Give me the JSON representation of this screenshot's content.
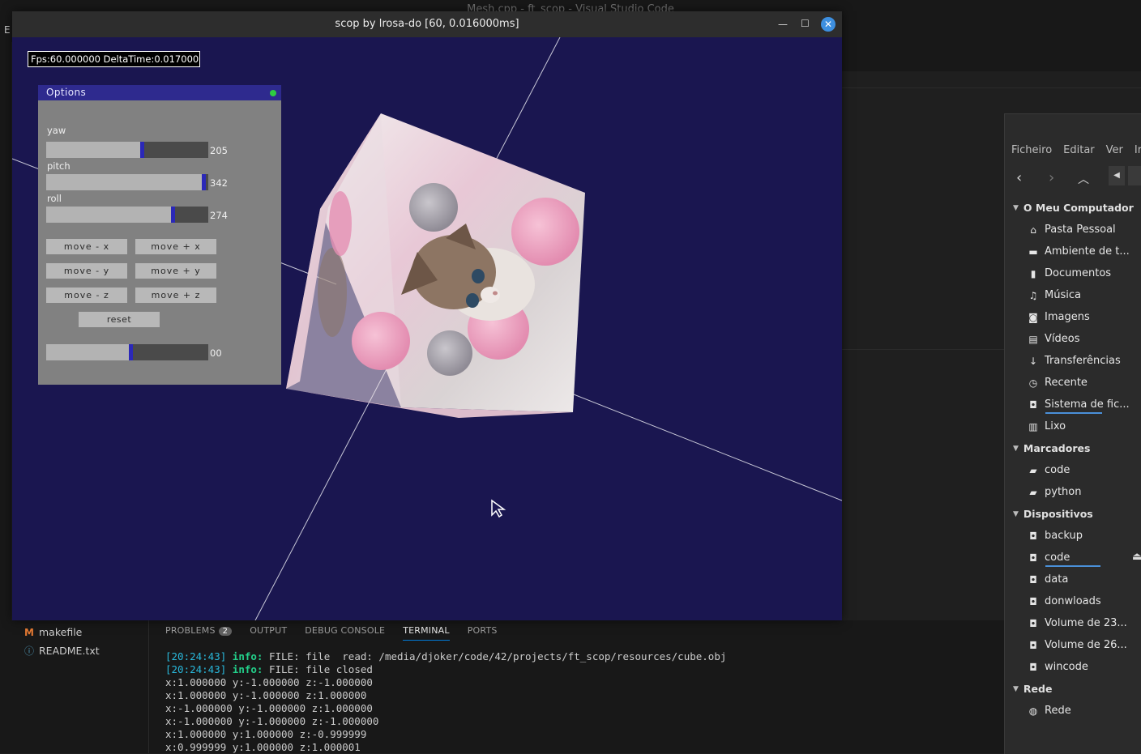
{
  "vscode": {
    "title": "Mesh.cpp - ft_scop - Visual Studio Code",
    "menu_first": "E",
    "files": [
      {
        "icon": "M",
        "name": "makefile"
      },
      {
        "icon": "ⓘ",
        "name": "README.txt"
      }
    ],
    "panel": {
      "tabs": [
        {
          "label": "PROBLEMS",
          "badge": "2"
        },
        {
          "label": "OUTPUT"
        },
        {
          "label": "DEBUG CONSOLE"
        },
        {
          "label": "TERMINAL",
          "active": true
        },
        {
          "label": "PORTS"
        }
      ],
      "terminal_lines": [
        {
          "stamp": "[20:24:43]",
          "level": "info:",
          "text": " FILE: file  read: /media/djoker/code/42/projects/ft_scop/resources/cube.obj"
        },
        {
          "stamp": "[20:24:43]",
          "level": "info:",
          "text": " FILE: file closed"
        },
        {
          "text": "x:1.000000 y:-1.000000 z:-1.000000"
        },
        {
          "text": "x:1.000000 y:-1.000000 z:1.000000"
        },
        {
          "text": "x:-1.000000 y:-1.000000 z:1.000000"
        },
        {
          "text": "x:-1.000000 y:-1.000000 z:-1.000000"
        },
        {
          "text": "x:1.000000 y:1.000000 z:-0.999999"
        },
        {
          "text": "x:0.999999 y:1.000000 z:1.000001"
        }
      ]
    }
  },
  "file_manager": {
    "menu": [
      "Ficheiro",
      "Editar",
      "Ver",
      "Ir"
    ],
    "sections": [
      {
        "title": "O Meu Computador",
        "items": [
          {
            "icon": "home-icon",
            "glyph": "⌂",
            "label": "Pasta Pessoal"
          },
          {
            "icon": "desktop-icon",
            "glyph": "▬",
            "label": "Ambiente de t..."
          },
          {
            "icon": "document-icon",
            "glyph": "▮",
            "label": "Documentos"
          },
          {
            "icon": "music-icon",
            "glyph": "♫",
            "label": "Música"
          },
          {
            "icon": "camera-icon",
            "glyph": "◙",
            "label": "Imagens"
          },
          {
            "icon": "film-icon",
            "glyph": "▤",
            "label": "Vídeos"
          },
          {
            "icon": "download-icon",
            "glyph": "↓",
            "label": "Transferências"
          },
          {
            "icon": "clock-icon",
            "glyph": "◷",
            "label": "Recente"
          },
          {
            "icon": "drive-icon",
            "glyph": "◘",
            "label": "Sistema de fic..."
          },
          {
            "icon": "trash-icon",
            "glyph": "▥",
            "label": "Lixo"
          }
        ]
      },
      {
        "title": "Marcadores",
        "items": [
          {
            "icon": "folder-icon",
            "glyph": "▰",
            "label": "code"
          },
          {
            "icon": "folder-icon",
            "glyph": "▰",
            "label": "python"
          }
        ]
      },
      {
        "title": "Dispositivos",
        "items": [
          {
            "icon": "drive-icon",
            "glyph": "◘",
            "label": "backup"
          },
          {
            "icon": "drive-icon",
            "glyph": "◘",
            "label": "code"
          },
          {
            "icon": "drive-icon",
            "glyph": "◘",
            "label": "data"
          },
          {
            "icon": "drive-icon",
            "glyph": "◘",
            "label": "donwloads"
          },
          {
            "icon": "drive-icon",
            "glyph": "◘",
            "label": "Volume de 23..."
          },
          {
            "icon": "drive-icon",
            "glyph": "◘",
            "label": "Volume de 26..."
          },
          {
            "icon": "drive-icon",
            "glyph": "◘",
            "label": "wincode"
          }
        ]
      },
      {
        "title": "Rede",
        "items": [
          {
            "icon": "network-icon",
            "glyph": "◍",
            "label": "Rede"
          }
        ]
      }
    ]
  },
  "scop": {
    "title": "scop by lrosa-do  [60, 0.016000ms]",
    "fps_text": "Fps:60.000000  DeltaTime:0.017000",
    "options": {
      "title": "Options",
      "sliders": [
        {
          "name": "yaw",
          "label": "yaw",
          "value": "205",
          "fraction": 0.58
        },
        {
          "name": "pitch",
          "label": "pitch",
          "value": "342",
          "fraction": 0.96
        },
        {
          "name": "roll",
          "label": "roll",
          "value": "274",
          "fraction": 0.77
        },
        {
          "name": "extra",
          "label": "",
          "value": "00",
          "fraction": 0.51
        }
      ],
      "buttons": [
        [
          "move  -  x",
          "move  +  x"
        ],
        [
          "move  -  y",
          "move  +  y"
        ],
        [
          "move  -  z",
          "move  +  z"
        ]
      ],
      "reset_label": "reset"
    }
  }
}
